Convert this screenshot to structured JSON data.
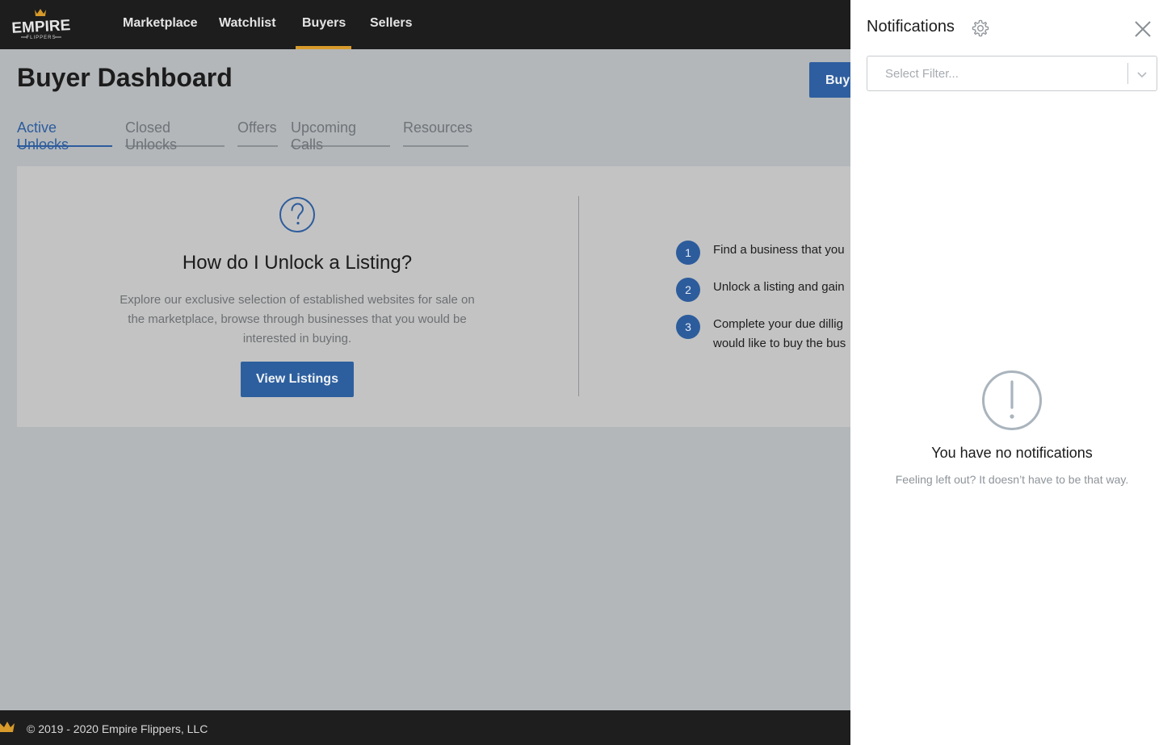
{
  "brand": {
    "name": "EMPIRE",
    "sub": "FLIPPERS",
    "accent": "#d79a2b"
  },
  "nav": {
    "items": [
      {
        "label": "Marketplace"
      },
      {
        "label": "Watchlist"
      },
      {
        "label": "Buyers",
        "active": true
      },
      {
        "label": "Sellers"
      }
    ]
  },
  "page": {
    "title": "Buyer Dashboard",
    "top_button": "Buy"
  },
  "tabs": [
    {
      "label": "Active Unlocks",
      "active": true
    },
    {
      "label": "Closed Unlocks"
    },
    {
      "label": "Offers"
    },
    {
      "label": "Upcoming Calls"
    },
    {
      "label": "Resources"
    }
  ],
  "card": {
    "icon": "question-circle-icon",
    "title": "How do I Unlock a Listing?",
    "text": "Explore our exclusive selection of established websites for sale on the marketplace, browse through businesses that you would be interested in buying.",
    "button": "View Listings",
    "steps": [
      {
        "num": "1",
        "line1": "Find a business that you"
      },
      {
        "num": "2",
        "line1": "Unlock a listing and gain"
      },
      {
        "num": "3",
        "line1": "Complete your due dillig",
        "line2": "would like to buy the bus"
      }
    ]
  },
  "footer": {
    "text": "© 2019 - 2020 Empire Flippers, LLC"
  },
  "notifications": {
    "title": "Notifications",
    "filter_placeholder": "Select Filter...",
    "empty_title": "You have no notifications",
    "empty_subtitle": "Feeling left out? It doesn’t have to be that way."
  },
  "colors": {
    "primary": "#2d5c9c",
    "overlay": "#b3b7ba",
    "nav_bg": "#1d1d1d"
  }
}
